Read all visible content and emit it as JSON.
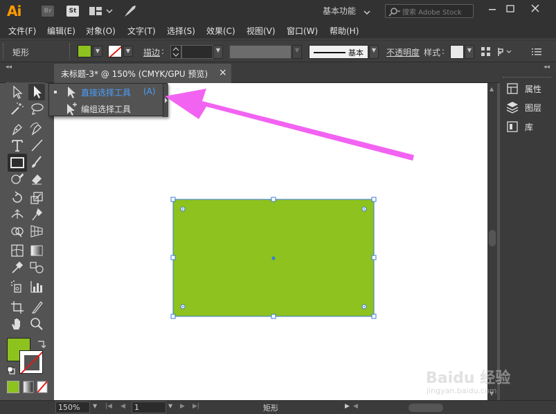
{
  "app": {
    "logo": "Ai",
    "bridge_label": "Br",
    "stock_label": "St",
    "workspace": "基本功能",
    "search_placeholder": "搜索 Adobe Stock"
  },
  "menu": [
    "文件(F)",
    "编辑(E)",
    "对象(O)",
    "文字(T)",
    "选择(S)",
    "效果(C)",
    "视图(V)",
    "窗口(W)",
    "帮助(H)"
  ],
  "control": {
    "object_type": "矩形",
    "stroke_label": "描边",
    "stroke_style": "基本",
    "opacity_label": "不透明度",
    "style_label": "样式"
  },
  "document": {
    "tab_title": "未标题-3* @ 150% (CMYK/GPU 预览)",
    "close_glyph": "×"
  },
  "flyout": {
    "items": [
      {
        "label": "直接选择工具",
        "shortcut": "(A)",
        "active": true
      },
      {
        "label": "编组选择工具",
        "shortcut": "",
        "active": false
      }
    ]
  },
  "panels": [
    {
      "label": "属性",
      "icon": "properties-icon"
    },
    {
      "label": "图层",
      "icon": "layers-icon"
    },
    {
      "label": "库",
      "icon": "libraries-icon"
    }
  ],
  "status": {
    "zoom": "150%",
    "artboard": "1",
    "current_tool": "矩形"
  },
  "colors": {
    "rect_fill": "#8dc21f",
    "selection_blue": "#3a7bd5",
    "arrow_magenta": "#f263f2",
    "shortcut_blue": "#4aa0ff"
  },
  "watermark": {
    "brand": "Baidu 经验",
    "url": "jingyan.baidu.com"
  }
}
